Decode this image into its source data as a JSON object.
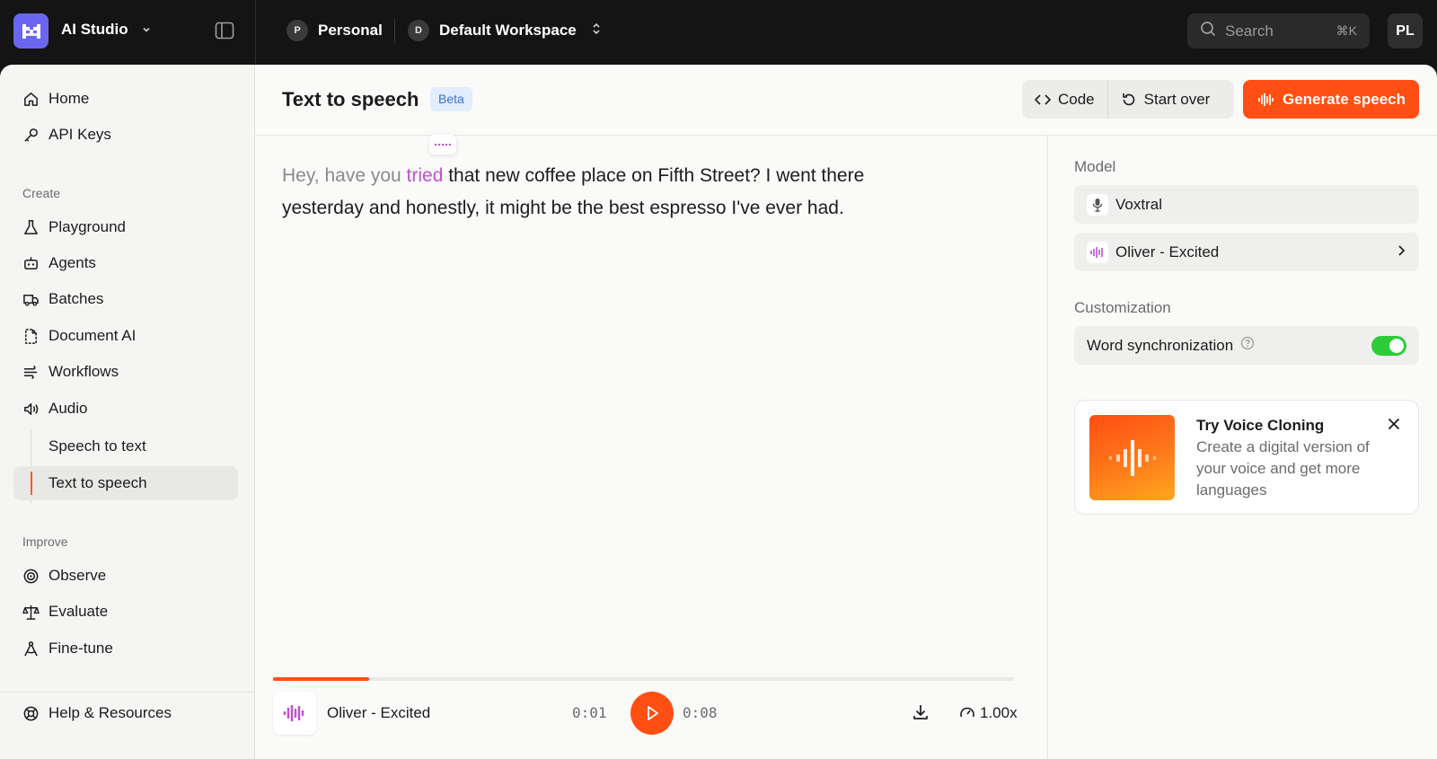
{
  "app": {
    "name": "AI Studio",
    "brand_color": "#6a66f1",
    "accent_color": "#ff4f12"
  },
  "topbar": {
    "org_badge": "P",
    "org_name": "Personal",
    "workspace_badge": "D",
    "workspace_name": "Default Workspace",
    "search_placeholder": "Search",
    "search_shortcut": "⌘K",
    "avatar_initials": "PL"
  },
  "sidebar": {
    "top_items": [
      {
        "label": "Home",
        "icon": "home-icon"
      },
      {
        "label": "API Keys",
        "icon": "key-icon"
      }
    ],
    "create_label": "Create",
    "create_items": [
      {
        "label": "Playground",
        "icon": "flask-icon"
      },
      {
        "label": "Agents",
        "icon": "robot-icon"
      },
      {
        "label": "Batches",
        "icon": "truck-icon"
      },
      {
        "label": "Document AI",
        "icon": "document-icon"
      },
      {
        "label": "Workflows",
        "icon": "wind-icon"
      },
      {
        "label": "Audio",
        "icon": "speaker-icon"
      }
    ],
    "audio_sub_items": [
      {
        "label": "Speech to text",
        "active": false
      },
      {
        "label": "Text to speech",
        "active": true
      }
    ],
    "improve_label": "Improve",
    "improve_items": [
      {
        "label": "Observe",
        "icon": "radar-icon"
      },
      {
        "label": "Evaluate",
        "icon": "scale-icon"
      },
      {
        "label": "Fine-tune",
        "icon": "compass-icon"
      }
    ],
    "footer_item": {
      "label": "Help & Resources",
      "icon": "lifebuoy-icon"
    }
  },
  "main": {
    "title": "Text to speech",
    "badge": "Beta",
    "code_label": "Code",
    "start_over_label": "Start over",
    "generate_label": "Generate speech",
    "editor": {
      "spoken": "Hey, have you ",
      "current": "tried",
      "remaining": " that new coffee place on Fifth Street? I went there yesterday and honestly, it might be the best espresso I've ever had."
    },
    "player": {
      "voice_name": "Oliver - Excited",
      "elapsed": "0:01",
      "duration": "0:08",
      "speed": "1.00x",
      "progress": 0.13
    }
  },
  "settings": {
    "model_label": "Model",
    "model_value": "Voxtral",
    "voice_value": "Oliver - Excited",
    "customization_label": "Customization",
    "word_sync_label": "Word synchronization",
    "word_sync_enabled": true
  },
  "promo": {
    "title": "Try Voice Cloning",
    "text": "Create a digital version of your voice and get more languages"
  }
}
